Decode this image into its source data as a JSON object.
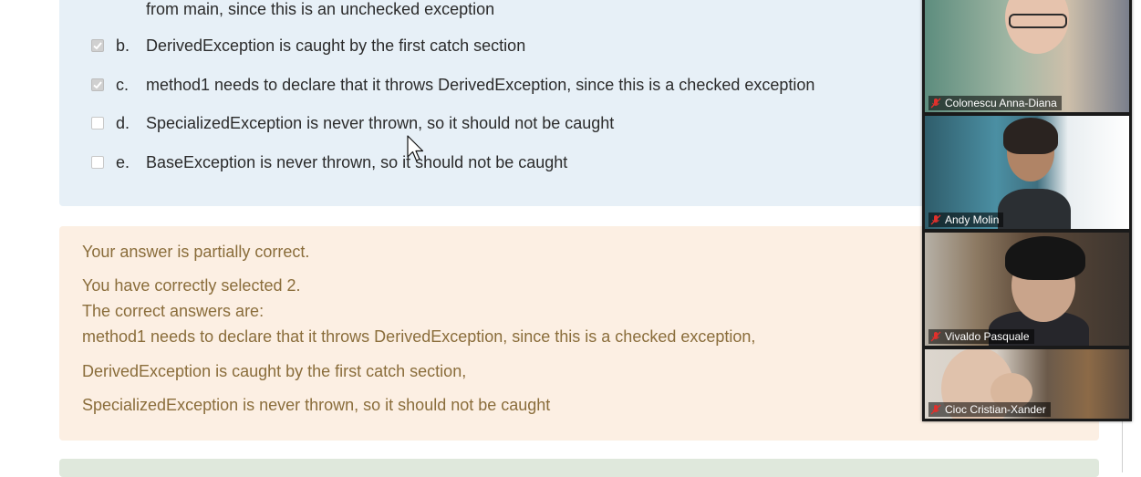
{
  "question": {
    "partial_text": "from main, since this is an unchecked exception",
    "options": [
      {
        "letter": "b.",
        "text": "DerivedException is caught by the first catch section",
        "checked": true
      },
      {
        "letter": "c.",
        "text": "method1 needs to declare that it throws DerivedException, since this is a checked exception",
        "checked": true
      },
      {
        "letter": "d.",
        "text": "SpecializedException is never thrown, so it should not be caught",
        "checked": false
      },
      {
        "letter": "e.",
        "text": "BaseException is never thrown, so it should not be caught",
        "checked": false
      }
    ]
  },
  "feedback": {
    "status": "Your answer is partially correct.",
    "count_text": "You have correctly selected 2.",
    "correct_header": "The correct answers are:",
    "answers": [
      "method1 needs to declare that it throws DerivedException, since this is a checked exception,",
      "DerivedException is caught by the first catch section,",
      "SpecializedException is never thrown, so it should not be caught"
    ]
  },
  "participants": [
    {
      "name": "Colonescu Anna-Diana",
      "icon": "muted-mic-icon"
    },
    {
      "name": "Andy Molin",
      "icon": "muted-mic-icon"
    },
    {
      "name": "Vivaldo Pasquale",
      "icon": "muted-mic-icon"
    },
    {
      "name": "Cioc Cristian-Xander",
      "icon": "muted-mic-icon"
    }
  ],
  "colors": {
    "question_bg": "#e7f0f7",
    "feedback_bg": "#fcefe3",
    "feedback_text": "#8a6d3b",
    "next_bg": "#dfe8dc",
    "mic_muted": "#e0302c"
  }
}
